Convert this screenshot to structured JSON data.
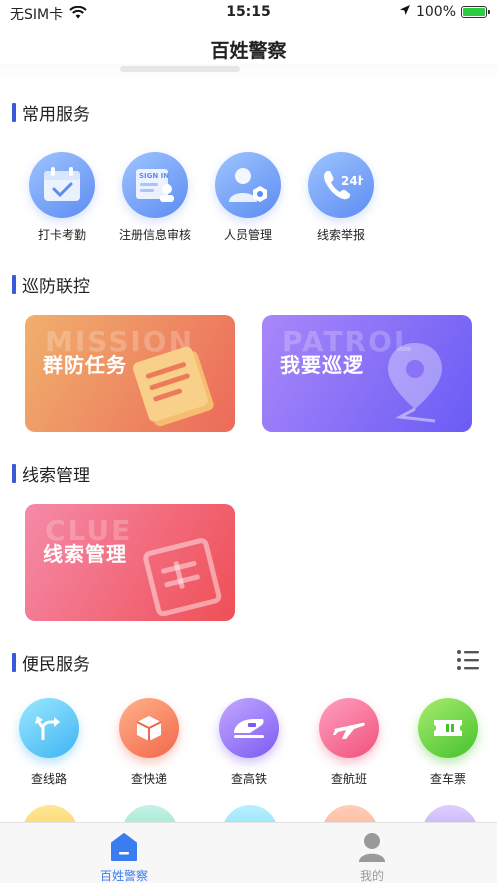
{
  "status_bar": {
    "carrier": "无SIM卡",
    "time": "15:15",
    "battery": "100%"
  },
  "nav": {
    "title": "百姓警察"
  },
  "sections": {
    "common": {
      "title": "常用服务"
    },
    "patrol": {
      "title": "巡防联控"
    },
    "clue": {
      "title": "线索管理"
    },
    "convenience": {
      "title": "便民服务"
    }
  },
  "common_services": [
    {
      "label": "打卡考勤",
      "icon": "calendar-check-icon"
    },
    {
      "label": "注册信息审核",
      "icon": "sign-in-form-icon"
    },
    {
      "label": "人员管理",
      "icon": "person-gear-icon"
    },
    {
      "label": "线索举报",
      "icon": "phone-24h-icon"
    }
  ],
  "patrol_cards": [
    {
      "title": "群防任务",
      "bg_word": "MISSION",
      "color_from": "#f2b06a",
      "color_to": "#ec6a5a"
    },
    {
      "title": "我要巡逻",
      "bg_word": "PATROL",
      "color_from": "#a786f8",
      "color_to": "#6a5cf5"
    }
  ],
  "clue_card": {
    "title": "线索管理",
    "bg_word": "CLUE",
    "color_from": "#f58aa8",
    "color_to": "#ef4f56"
  },
  "convenience_services": [
    {
      "label": "查线路",
      "icon": "route-icon",
      "color_from": "#8fe6ff",
      "color_to": "#3fb4f2"
    },
    {
      "label": "查快递",
      "icon": "package-icon",
      "color_from": "#ffb38a",
      "color_to": "#f2664a"
    },
    {
      "label": "查高铁",
      "icon": "train-icon",
      "color_from": "#c3a8ff",
      "color_to": "#7b5bf2"
    },
    {
      "label": "查航班",
      "icon": "airplane-icon",
      "color_from": "#ff9fc0",
      "color_to": "#f0517a"
    },
    {
      "label": "查车票",
      "icon": "ticket-icon",
      "color_from": "#a8ec6f",
      "color_to": "#45c22b"
    }
  ],
  "tabbar": [
    {
      "label": "百姓警察",
      "icon": "home-icon",
      "active": true,
      "color": "#3a7df0"
    },
    {
      "label": "我的",
      "icon": "user-icon",
      "active": false,
      "color": "#999999"
    }
  ]
}
